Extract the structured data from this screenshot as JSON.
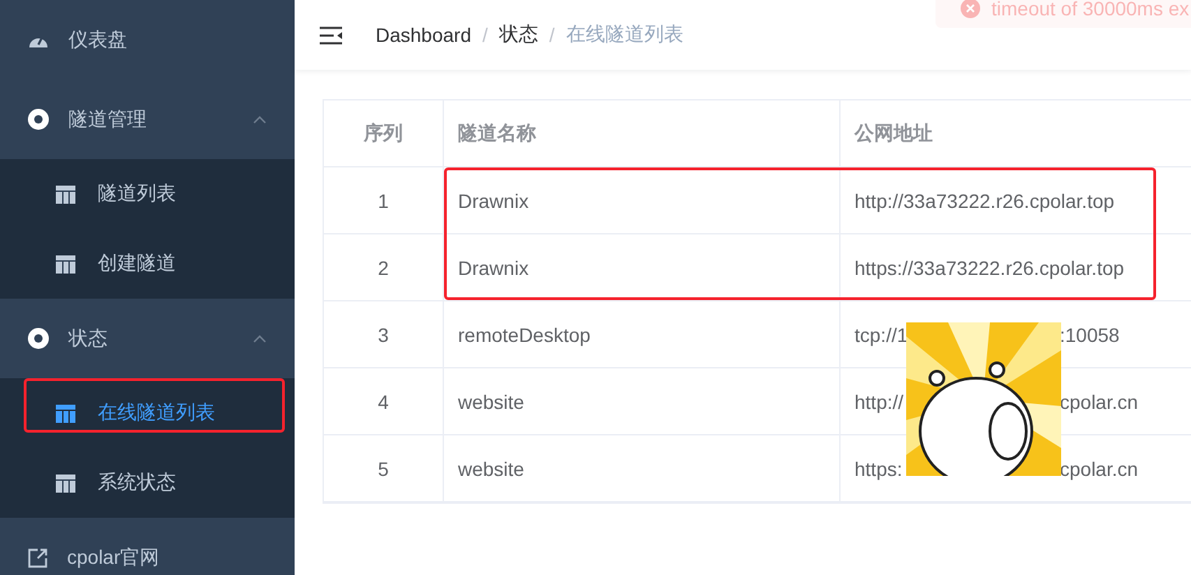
{
  "sidebar": {
    "items": [
      {
        "kind": "dashboard",
        "label": "仪表盘"
      },
      {
        "kind": "group",
        "label": "隧道管理",
        "expanded": true,
        "children": [
          {
            "label": "隧道列表",
            "selected": false
          },
          {
            "label": "创建隧道",
            "selected": false
          }
        ]
      },
      {
        "kind": "group",
        "label": "状态",
        "expanded": true,
        "children": [
          {
            "label": "在线隧道列表",
            "selected": true
          },
          {
            "label": "系统状态",
            "selected": false
          }
        ]
      },
      {
        "kind": "link",
        "label": "cpolar官网"
      }
    ]
  },
  "breadcrumb": {
    "items": [
      "Dashboard",
      "状态",
      "在线隧道列表"
    ],
    "separator": "/"
  },
  "toast": {
    "message": "timeout of 30000ms ex"
  },
  "table": {
    "columns": [
      "序列",
      "隧道名称",
      "公网地址"
    ],
    "rows": [
      {
        "index": "1",
        "name": "Drawnix",
        "address": [
          "http://33a73222.r26.cpolar.top"
        ]
      },
      {
        "index": "2",
        "name": "Drawnix",
        "address": [
          "https://33a73222.r26.cpolar.top"
        ]
      },
      {
        "index": "3",
        "name": "remoteDesktop",
        "address": [
          "tcp://1",
          ":10058"
        ]
      },
      {
        "index": "4",
        "name": "website",
        "address": [
          "http://",
          "cpolar.cn"
        ]
      },
      {
        "index": "5",
        "name": "website",
        "address": [
          "https:",
          "cpolar.cn"
        ]
      }
    ]
  }
}
